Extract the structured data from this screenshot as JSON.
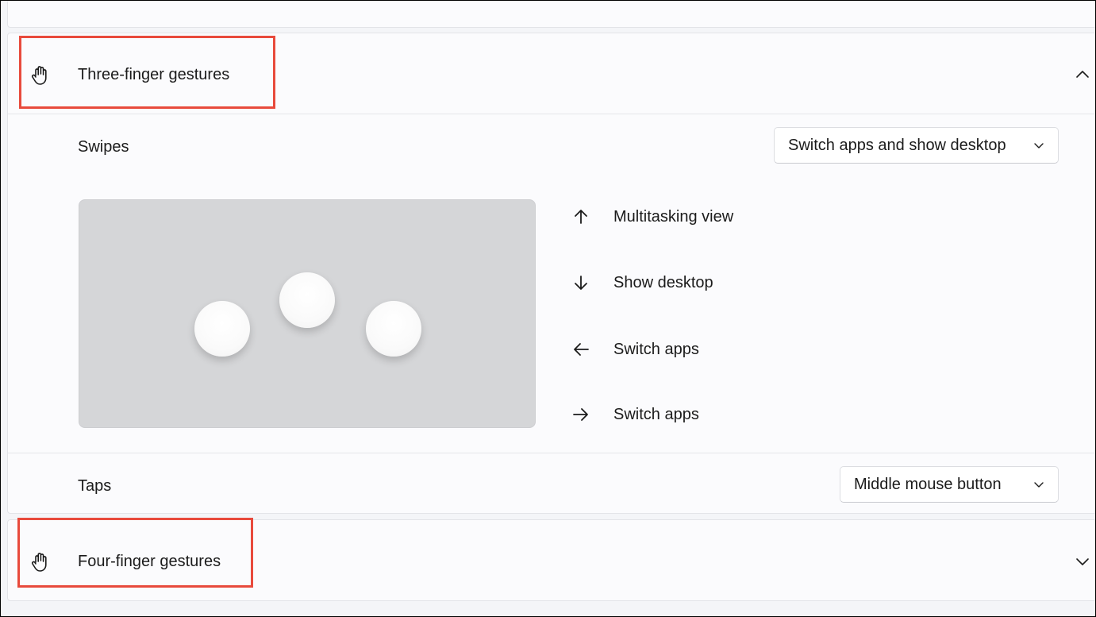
{
  "three_finger": {
    "title": "Three-finger gestures",
    "expanded": true,
    "swipes": {
      "label": "Swipes",
      "selected": "Switch apps and show desktop"
    },
    "gestures": [
      {
        "direction": "up",
        "icon": "arrow-up-icon",
        "label": "Multitasking view"
      },
      {
        "direction": "down",
        "icon": "arrow-down-icon",
        "label": "Show desktop"
      },
      {
        "direction": "left",
        "icon": "arrow-left-icon",
        "label": "Switch apps"
      },
      {
        "direction": "right",
        "icon": "arrow-right-icon",
        "label": "Switch apps"
      }
    ],
    "taps": {
      "label": "Taps",
      "selected": "Middle mouse button"
    }
  },
  "four_finger": {
    "title": "Four-finger gestures",
    "expanded": false
  },
  "colors": {
    "highlight": "#e84a3c",
    "card_bg": "#fbfbfd",
    "touchpad": "#d5d6d8"
  }
}
